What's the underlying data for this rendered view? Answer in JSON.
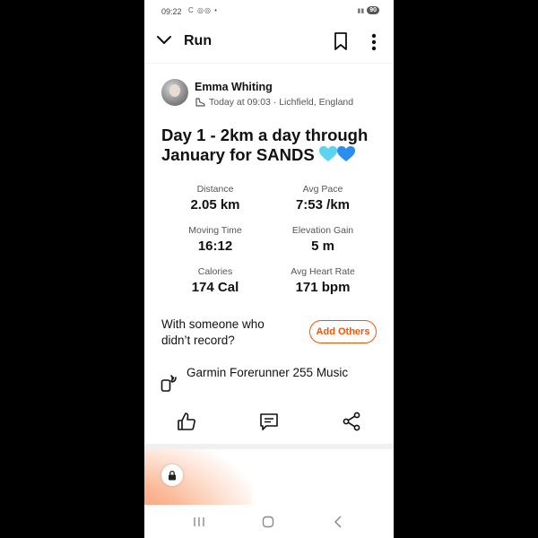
{
  "status_bar": {
    "time": "09:22",
    "left_icons": "C ◎◎ •",
    "battery": "90"
  },
  "header": {
    "title": "Run"
  },
  "activity": {
    "athlete": "Emma Whiting",
    "meta": "Today at 09:03 · Lichfield, England",
    "title": "Day 1 - 2km a day through January for SANDS",
    "stats": [
      {
        "label": "Distance",
        "value": "2.05 km"
      },
      {
        "label": "Avg Pace",
        "value": "7:53 /km"
      },
      {
        "label": "Moving Time",
        "value": "16:12"
      },
      {
        "label": "Elevation Gain",
        "value": "5 m"
      },
      {
        "label": "Calories",
        "value": "174 Cal"
      },
      {
        "label": "Avg Heart Rate",
        "value": "171 bpm"
      }
    ],
    "with_someone": "With someone who didn’t record?",
    "add_others": "Add Others",
    "device": "Garmin Forerunner 255 Music"
  },
  "colors": {
    "accent": "#fc5200",
    "heart_light": "#5ad4f0",
    "heart_dark": "#2a8df0"
  },
  "icons": {
    "back": "chevron-down-icon",
    "bookmark": "bookmark-icon",
    "more": "more-vertical-icon",
    "shoe": "shoe-icon",
    "device": "watch-sync-icon",
    "like": "thumbs-up-icon",
    "comment": "comment-icon",
    "share": "share-icon",
    "lock": "lock-icon"
  }
}
